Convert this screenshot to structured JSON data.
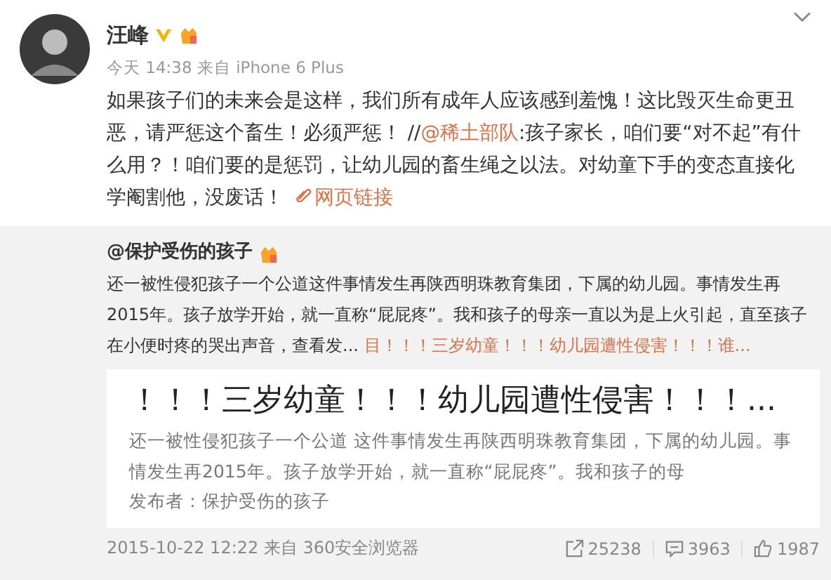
{
  "post": {
    "author": "汪峰",
    "verified": true,
    "meta": "今天 14:38 来自 iPhone 6 Plus",
    "text_before": "如果孩子们的未来会是这样，我们所有成年人应该感到羞愧！这比毁灭生命更丑恶，请严惩这个畜生！必须严惩！ //",
    "mention": "@稀土部队",
    "text_after": ":孩子家长，咱们要“对不起”有什么用？！咱们要的是惩罚，让幼儿园的畜生绳之以法。对幼童下手的变态直接化学阉割他，没废话！",
    "link": "网页链接"
  },
  "repost": {
    "author": "@保护受伤的孩子",
    "text": "还一被性侵犯孩子一个公道这件事情发生再陕西明珠教育集团，下属的幼儿园。事情发生再2015年。孩子放学开始，就一直称“屁屁疼”。我和孩子的母亲一直以为是上火引起，直至孩子在小便时疼的哭出声音，查看发...",
    "link": "目！！！三岁幼童！！！幼儿园遭性侵害！！！谁...",
    "card": {
      "title": "！！！三岁幼童！！！幼儿园遭性侵害！！！...",
      "summary": "还一被性侵犯孩子一个公道 这件事情发生再陕西明珠教育集团，下属的幼儿园。事情发生再2015年。孩子放学开始，就一直称“屁屁疼”。我和孩子的母",
      "publisher": "发布者：保护受伤的孩子"
    },
    "meta": "2015-10-22 12:22 来自 360安全浏览器",
    "stats": [
      {
        "kind": "share",
        "count": "25238"
      },
      {
        "kind": "comment",
        "count": "3963"
      },
      {
        "kind": "like",
        "count": "1987"
      }
    ]
  }
}
